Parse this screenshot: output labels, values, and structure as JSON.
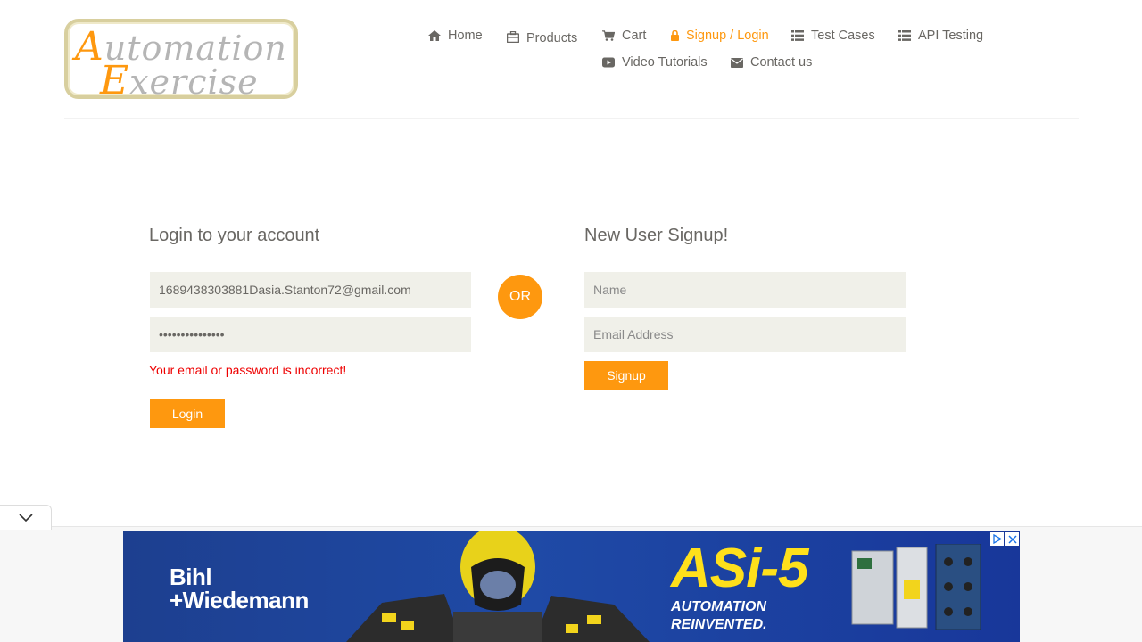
{
  "logo": {
    "line1_cap": "A",
    "line1_rest": "utomation",
    "line2_cap": "E",
    "line2_rest": "xercise"
  },
  "nav": [
    {
      "label": "Home",
      "icon": "home-icon"
    },
    {
      "label": "Products",
      "icon": "briefcase-icon"
    },
    {
      "label": "Cart",
      "icon": "cart-icon"
    },
    {
      "label": "Signup / Login",
      "icon": "lock-icon",
      "active": true
    },
    {
      "label": "Test Cases",
      "icon": "list-icon"
    },
    {
      "label": "API Testing",
      "icon": "list-icon"
    },
    {
      "label": "Video Tutorials",
      "icon": "youtube-play-icon"
    },
    {
      "label": "Contact us",
      "icon": "envelope-icon"
    }
  ],
  "login": {
    "title": "Login to your account",
    "email_value": "1689438303881Dasia.Stanton72@gmail.com",
    "password_value": "•••••••••••••••",
    "error": "Your email or password is incorrect!",
    "button": "Login"
  },
  "or_label": "OR",
  "signup": {
    "title": "New User Signup!",
    "name_placeholder": "Name",
    "email_placeholder": "Email Address",
    "button": "Signup"
  },
  "ad": {
    "brand_line1": "Bihl",
    "brand_line2": "+Wiedemann",
    "title": "ASi-5",
    "sub_line1": "AUTOMATION",
    "sub_line2": "REINVENTED."
  },
  "colors": {
    "accent": "#fe980f",
    "text": "#696763",
    "field_bg": "#f0f0e9",
    "error": "#ee0000"
  }
}
